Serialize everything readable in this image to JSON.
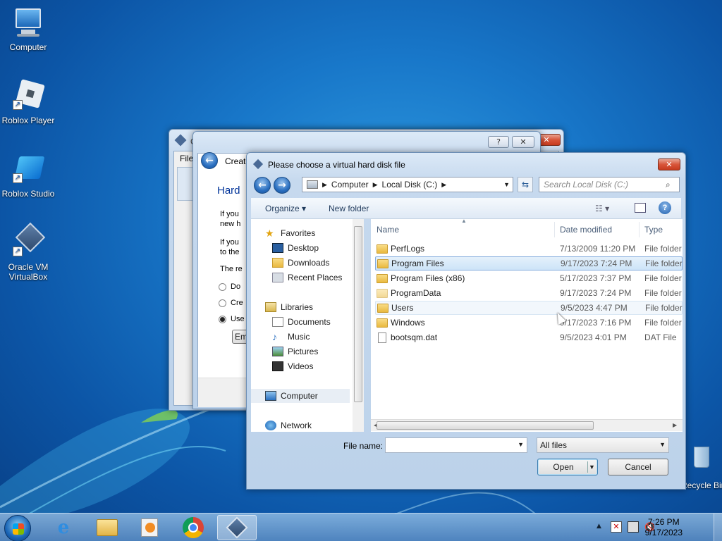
{
  "desktop": {
    "icons": [
      {
        "label": "Computer"
      },
      {
        "label": "Roblox Player"
      },
      {
        "label": "Roblox Studio"
      },
      {
        "label": "Oracle VM VirtualBox"
      },
      {
        "label": "Recycle Bin"
      }
    ]
  },
  "back_window": {
    "title_partial": "C",
    "menu_partial": "File"
  },
  "wizard_window": {
    "title_partial": "Create",
    "heading_partial": "Hard",
    "paragraph1": [
      "If you",
      "new h"
    ],
    "paragraph2": [
      "If you",
      "to the"
    ],
    "paragraph3": "The re",
    "radio_do": "Do",
    "radio_cre": "Cre",
    "radio_use": "Use",
    "button_partial": "Em",
    "help_glyph": "?",
    "close_glyph": "✕"
  },
  "dialog": {
    "title": "Please choose a virtual hard disk file",
    "close_glyph": "✕",
    "breadcrumb": [
      "Computer",
      "Local Disk (C:)"
    ],
    "search_placeholder": "Search Local Disk (C:)",
    "toolbar": {
      "organize": "Organize",
      "new_folder": "New folder"
    },
    "nav": {
      "favorites": "Favorites",
      "desktop": "Desktop",
      "downloads": "Downloads",
      "recent": "Recent Places",
      "libraries": "Libraries",
      "documents": "Documents",
      "music": "Music",
      "pictures": "Pictures",
      "videos": "Videos",
      "computer": "Computer",
      "network": "Network"
    },
    "columns": {
      "name": "Name",
      "date": "Date modified",
      "type": "Type"
    },
    "files": [
      {
        "name": "PerfLogs",
        "date": "7/13/2009 11:20 PM",
        "type": "File folder"
      },
      {
        "name": "Program Files",
        "date": "9/17/2023 7:24 PM",
        "type": "File folder"
      },
      {
        "name": "Program Files (x86)",
        "date": "5/17/2023 7:37 PM",
        "type": "File folder"
      },
      {
        "name": "ProgramData",
        "date": "9/17/2023 7:24 PM",
        "type": "File folder"
      },
      {
        "name": "Users",
        "date": "9/5/2023 4:47 PM",
        "type": "File folder"
      },
      {
        "name": "Windows",
        "date": "9/17/2023 7:16 PM",
        "type": "File folder"
      },
      {
        "name": "bootsqm.dat",
        "date": "9/5/2023 4:01 PM",
        "type": "DAT File"
      }
    ],
    "file_name_label": "File name:",
    "file_name_value": "",
    "filter": "All files",
    "open": "Open",
    "cancel": "Cancel"
  },
  "taskbar": {
    "time": "7:26 PM",
    "date": "9/17/2023"
  }
}
